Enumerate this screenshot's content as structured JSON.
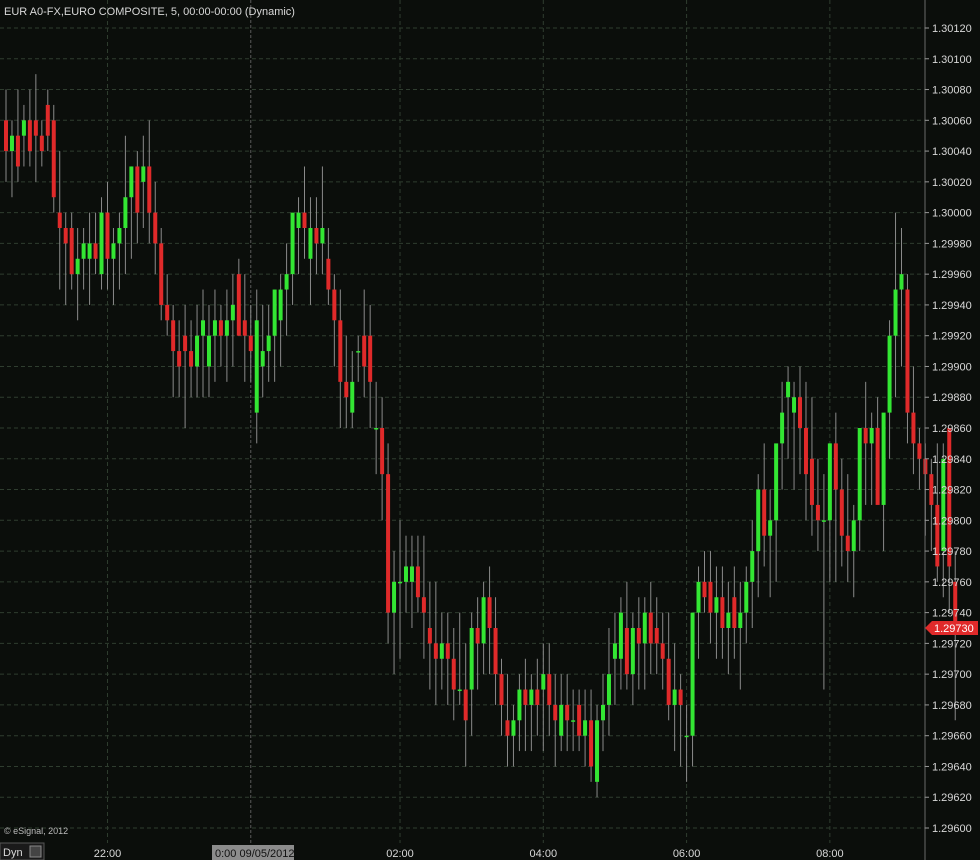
{
  "title": "EUR A0-FX,EURO COMPOSITE, 5, 00:00-00:00 (Dynamic)",
  "copyright": "© eSignal, 2012",
  "mode_button": "Dyn",
  "cursor_date_label": "0:00 09/05/2012",
  "last_price_label": "1.29730",
  "colors": {
    "background": "#0b0e0b",
    "grid": "#2f3d2f",
    "up": "#33e633",
    "down": "#e02a2a",
    "wick": "#8a8a8a",
    "text": "#d8d8d8",
    "price_tag": "#e02a2a"
  },
  "chart_data": {
    "type": "candlestick",
    "title": "EUR A0-FX,EURO COMPOSITE, 5, 00:00-00:00 (Dynamic)",
    "interval_minutes": 5,
    "x_tick_labels": [
      "22:00",
      "02:00",
      "04:00",
      "06:00",
      "08:00"
    ],
    "x_tick_times": [
      "22:00",
      "02:00",
      "04:00",
      "06:00",
      "08:00"
    ],
    "session_marker": "0:00 09/05/2012",
    "ylim": [
      1.296,
      1.3012
    ],
    "y_ticks": [
      1.3012,
      1.301,
      1.3008,
      1.3006,
      1.3004,
      1.3002,
      1.3,
      1.2998,
      1.2996,
      1.2994,
      1.2992,
      1.299,
      1.2988,
      1.2986,
      1.2984,
      1.2982,
      1.298,
      1.2978,
      1.2976,
      1.2974,
      1.2972,
      1.297,
      1.2968,
      1.2966,
      1.2964,
      1.2962,
      1.296
    ],
    "y_tick_labels": [
      "1.30120",
      "1.30100",
      "1.30080",
      "1.30060",
      "1.30040",
      "1.30020",
      "1.30000",
      "1.29980",
      "1.29960",
      "1.29940",
      "1.29920",
      "1.29900",
      "1.29880",
      "1.29860",
      "1.29840",
      "1.29820",
      "1.29800",
      "1.29780",
      "1.29760",
      "1.29740",
      "1.29720",
      "1.29700",
      "1.29680",
      "1.29660",
      "1.29640",
      "1.29620",
      "1.29600"
    ],
    "last_price": 1.2973,
    "grid": true,
    "candles_ohlc": [
      [
        1.3006,
        1.3008,
        1.3002,
        1.3004
      ],
      [
        1.3004,
        1.3006,
        1.3001,
        1.3005
      ],
      [
        1.3005,
        1.3008,
        1.3002,
        1.3003
      ],
      [
        1.3005,
        1.3007,
        1.3003,
        1.3006
      ],
      [
        1.3006,
        1.3008,
        1.3003,
        1.3004
      ],
      [
        1.3006,
        1.3009,
        1.3002,
        1.3005
      ],
      [
        1.3005,
        1.3006,
        1.3003,
        1.3004
      ],
      [
        1.3007,
        1.3008,
        1.3004,
        1.3005
      ],
      [
        1.3006,
        1.3007,
        1.3,
        1.3001
      ],
      [
        1.3,
        1.3004,
        1.2995,
        1.2999
      ],
      [
        1.2999,
        1.3,
        1.2994,
        1.2998
      ],
      [
        1.2999,
        1.3,
        1.2995,
        1.2996
      ],
      [
        1.2996,
        1.2999,
        1.2993,
        1.2997
      ],
      [
        1.2997,
        1.2999,
        1.2995,
        1.2998
      ],
      [
        1.2997,
        1.3,
        1.2994,
        1.2998
      ],
      [
        1.2998,
        1.3,
        1.2996,
        1.2997
      ],
      [
        1.2996,
        1.3001,
        1.2995,
        1.3
      ],
      [
        1.3,
        1.3002,
        1.2995,
        1.2997
      ],
      [
        1.2997,
        1.2999,
        1.2994,
        1.2998
      ],
      [
        1.2998,
        1.3,
        1.2995,
        1.2999
      ],
      [
        1.2999,
        1.3005,
        1.2996,
        1.3001
      ],
      [
        1.3001,
        1.3003,
        1.2997,
        1.3003
      ],
      [
        1.3003,
        1.3004,
        1.2998,
        1.3
      ],
      [
        1.3002,
        1.3005,
        1.2999,
        1.3003
      ],
      [
        1.3003,
        1.3006,
        1.2998,
        1.3
      ],
      [
        1.3,
        1.3002,
        1.2996,
        1.2998
      ],
      [
        1.2998,
        1.2999,
        1.2993,
        1.2994
      ],
      [
        1.2994,
        1.2996,
        1.2992,
        1.2993
      ],
      [
        1.2993,
        1.2994,
        1.2988,
        1.2991
      ],
      [
        1.2991,
        1.2993,
        1.2988,
        1.299
      ],
      [
        1.2992,
        1.2994,
        1.2986,
        1.2991
      ],
      [
        1.2991,
        1.2993,
        1.2988,
        1.299
      ],
      [
        1.299,
        1.2994,
        1.2988,
        1.2992
      ],
      [
        1.2992,
        1.2995,
        1.2988,
        1.2993
      ],
      [
        1.299,
        1.2994,
        1.2988,
        1.2992
      ],
      [
        1.2992,
        1.2995,
        1.2989,
        1.2993
      ],
      [
        1.2993,
        1.2994,
        1.299,
        1.2992
      ],
      [
        1.2992,
        1.2995,
        1.2989,
        1.2993
      ],
      [
        1.2993,
        1.2996,
        1.299,
        1.2994
      ],
      [
        1.2996,
        1.2997,
        1.2992,
        1.2992
      ],
      [
        1.2993,
        1.2996,
        1.2989,
        1.2992
      ],
      [
        1.2992,
        1.2994,
        1.2989,
        1.2991
      ],
      [
        1.2987,
        1.2995,
        1.2985,
        1.2993
      ],
      [
        1.299,
        1.2994,
        1.2988,
        1.2991
      ],
      [
        1.2991,
        1.2994,
        1.2989,
        1.2992
      ],
      [
        1.2992,
        1.2995,
        1.2989,
        1.2995
      ],
      [
        1.2993,
        1.2996,
        1.299,
        1.2995
      ],
      [
        1.2995,
        1.2998,
        1.2992,
        1.2996
      ],
      [
        1.2996,
        1.2999,
        1.2994,
        1.3
      ],
      [
        1.2999,
        1.3001,
        1.2996,
        1.3
      ],
      [
        1.3,
        1.3003,
        1.2997,
        1.2999
      ],
      [
        1.2997,
        1.3001,
        1.2994,
        1.2999
      ],
      [
        1.2999,
        1.3001,
        1.2996,
        1.2998
      ],
      [
        1.2998,
        1.3003,
        1.2996,
        1.2999
      ],
      [
        1.2997,
        1.2999,
        1.2994,
        1.2995
      ],
      [
        1.2995,
        1.2996,
        1.299,
        1.2993
      ],
      [
        1.2993,
        1.2995,
        1.2986,
        1.2989
      ],
      [
        1.2989,
        1.2992,
        1.2986,
        1.2988
      ],
      [
        1.2987,
        1.2991,
        1.2986,
        1.2989
      ],
      [
        1.2991,
        1.2992,
        1.2989,
        1.2991
      ],
      [
        1.2992,
        1.2995,
        1.2988,
        1.299
      ],
      [
        1.2992,
        1.2994,
        1.2986,
        1.2989
      ],
      [
        1.2986,
        1.2989,
        1.2983,
        1.2986
      ],
      [
        1.2986,
        1.2988,
        1.298,
        1.2983
      ],
      [
        1.2983,
        1.2985,
        1.2972,
        1.2974
      ],
      [
        1.2974,
        1.2978,
        1.297,
        1.2976
      ],
      [
        1.2976,
        1.298,
        1.2971,
        1.2976
      ],
      [
        1.2976,
        1.2979,
        1.2974,
        1.2977
      ],
      [
        1.2976,
        1.2979,
        1.2973,
        1.2977
      ],
      [
        1.2977,
        1.2979,
        1.2974,
        1.2975
      ],
      [
        1.2975,
        1.2979,
        1.2971,
        1.2974
      ],
      [
        1.2973,
        1.2976,
        1.2969,
        1.2972
      ],
      [
        1.2972,
        1.2976,
        1.2968,
        1.2971
      ],
      [
        1.2971,
        1.2974,
        1.2969,
        1.2972
      ],
      [
        1.2972,
        1.2974,
        1.2968,
        1.2971
      ],
      [
        1.2971,
        1.2973,
        1.2967,
        1.2969
      ],
      [
        1.2969,
        1.2974,
        1.2968,
        1.2969
      ],
      [
        1.2969,
        1.2972,
        1.2964,
        1.2967
      ],
      [
        1.2969,
        1.2974,
        1.2966,
        1.2973
      ],
      [
        1.2973,
        1.2975,
        1.2969,
        1.2972
      ],
      [
        1.2972,
        1.2976,
        1.297,
        1.2975
      ],
      [
        1.2975,
        1.2977,
        1.297,
        1.2973
      ],
      [
        1.2973,
        1.2975,
        1.2968,
        1.297
      ],
      [
        1.297,
        1.2971,
        1.2966,
        1.2968
      ],
      [
        1.2967,
        1.297,
        1.2964,
        1.2966
      ],
      [
        1.2966,
        1.2968,
        1.2964,
        1.2967
      ],
      [
        1.2967,
        1.297,
        1.2965,
        1.2969
      ],
      [
        1.2969,
        1.2971,
        1.2965,
        1.2968
      ],
      [
        1.2968,
        1.297,
        1.2965,
        1.2969
      ],
      [
        1.2969,
        1.2971,
        1.2966,
        1.2968
      ],
      [
        1.2969,
        1.2972,
        1.2965,
        1.297
      ],
      [
        1.297,
        1.2972,
        1.2966,
        1.2968
      ],
      [
        1.2968,
        1.297,
        1.2964,
        1.2967
      ],
      [
        1.2966,
        1.297,
        1.2965,
        1.2968
      ],
      [
        1.2968,
        1.297,
        1.2965,
        1.2967
      ],
      [
        1.2967,
        1.2969,
        1.2965,
        1.2967
      ],
      [
        1.2968,
        1.2969,
        1.2965,
        1.2966
      ],
      [
        1.2966,
        1.2969,
        1.2964,
        1.2967
      ],
      [
        1.2967,
        1.2969,
        1.2963,
        1.2964
      ],
      [
        1.2963,
        1.2968,
        1.2962,
        1.2967
      ],
      [
        1.2967,
        1.297,
        1.2965,
        1.2968
      ],
      [
        1.2968,
        1.2973,
        1.2966,
        1.297
      ],
      [
        1.2971,
        1.2974,
        1.2968,
        1.2972
      ],
      [
        1.2971,
        1.2975,
        1.2969,
        1.2974
      ],
      [
        1.2973,
        1.2976,
        1.2969,
        1.297
      ],
      [
        1.297,
        1.2974,
        1.2968,
        1.2973
      ],
      [
        1.2973,
        1.2975,
        1.2969,
        1.2972
      ],
      [
        1.2972,
        1.2975,
        1.2969,
        1.2974
      ],
      [
        1.2974,
        1.2976,
        1.297,
        1.2972
      ],
      [
        1.2973,
        1.2975,
        1.297,
        1.2972
      ],
      [
        1.2972,
        1.2974,
        1.2969,
        1.2971
      ],
      [
        1.2971,
        1.2974,
        1.2967,
        1.2968
      ],
      [
        1.2968,
        1.2972,
        1.2965,
        1.2969
      ],
      [
        1.2969,
        1.297,
        1.2964,
        1.2968
      ],
      [
        1.2966,
        1.2968,
        1.2963,
        1.2966
      ],
      [
        1.2966,
        1.2974,
        1.2964,
        1.2974
      ],
      [
        1.2974,
        1.2977,
        1.2971,
        1.2976
      ],
      [
        1.2976,
        1.2978,
        1.2974,
        1.2975
      ],
      [
        1.2976,
        1.2978,
        1.2972,
        1.2974
      ],
      [
        1.2974,
        1.2977,
        1.2971,
        1.2975
      ],
      [
        1.2975,
        1.2977,
        1.2971,
        1.2973
      ],
      [
        1.2973,
        1.2976,
        1.297,
        1.2974
      ],
      [
        1.2975,
        1.2977,
        1.2971,
        1.2973
      ],
      [
        1.2973,
        1.2976,
        1.2969,
        1.2974
      ],
      [
        1.2974,
        1.2977,
        1.2972,
        1.2976
      ],
      [
        1.2976,
        1.298,
        1.2973,
        1.2978
      ],
      [
        1.2978,
        1.2983,
        1.2975,
        1.2982
      ],
      [
        1.2982,
        1.2985,
        1.2977,
        1.2979
      ],
      [
        1.2979,
        1.2982,
        1.2975,
        1.298
      ],
      [
        1.298,
        1.2984,
        1.2976,
        1.2985
      ],
      [
        1.2985,
        1.2989,
        1.2982,
        1.2987
      ],
      [
        1.2988,
        1.299,
        1.2984,
        1.2989
      ],
      [
        1.2987,
        1.2989,
        1.2982,
        1.2988
      ],
      [
        1.2988,
        1.299,
        1.2983,
        1.2986
      ],
      [
        1.2986,
        1.2989,
        1.298,
        1.2983
      ],
      [
        1.2984,
        1.2988,
        1.2979,
        1.2981
      ],
      [
        1.2981,
        1.2984,
        1.2978,
        1.298
      ],
      [
        1.298,
        1.2983,
        1.2969,
        1.298
      ],
      [
        1.298,
        1.2985,
        1.2976,
        1.2985
      ],
      [
        1.2985,
        1.2987,
        1.2976,
        1.2982
      ],
      [
        1.2982,
        1.2984,
        1.2977,
        1.2979
      ],
      [
        1.2979,
        1.2983,
        1.2976,
        1.2978
      ],
      [
        1.2978,
        1.2981,
        1.2975,
        1.298
      ],
      [
        1.298,
        1.2986,
        1.2978,
        1.2986
      ],
      [
        1.2986,
        1.2989,
        1.2981,
        1.2985
      ],
      [
        1.2985,
        1.2987,
        1.2981,
        1.2986
      ],
      [
        1.2986,
        1.2988,
        1.2982,
        1.2981
      ],
      [
        1.2981,
        1.2986,
        1.2978,
        1.2987
      ],
      [
        1.2987,
        1.2993,
        1.2984,
        1.2992
      ],
      [
        1.2992,
        1.3,
        1.2988,
        1.2995
      ],
      [
        1.2995,
        1.2999,
        1.299,
        1.2996
      ],
      [
        1.2995,
        1.2996,
        1.2985,
        1.2987
      ],
      [
        1.2987,
        1.299,
        1.2983,
        1.2985
      ],
      [
        1.2985,
        1.2986,
        1.2982,
        1.2984
      ],
      [
        1.2984,
        1.2985,
        1.2979,
        1.2983
      ],
      [
        1.2983,
        1.2984,
        1.2978,
        1.2981
      ],
      [
        1.2981,
        1.2985,
        1.2976,
        1.2977
      ],
      [
        1.2978,
        1.2985,
        1.2975,
        1.2984
      ],
      [
        1.2986,
        1.2986,
        1.2974,
        1.2977
      ],
      [
        1.2976,
        1.2978,
        1.2967,
        1.2973
      ]
    ]
  }
}
